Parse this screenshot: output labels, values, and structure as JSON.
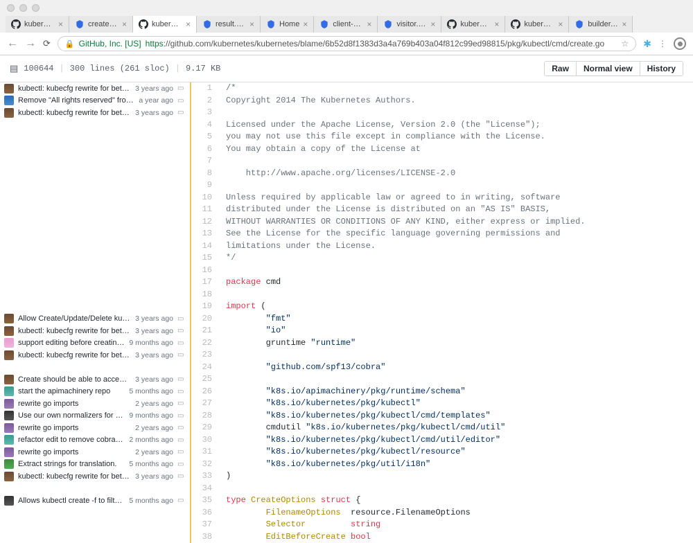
{
  "browser": {
    "tabs": [
      {
        "title": "kubernetes/r",
        "icon": "github"
      },
      {
        "title": "create.go —",
        "icon": "k8s"
      },
      {
        "title": "kubernetes/h",
        "icon": "github"
      },
      {
        "title": "result.go — k",
        "icon": "k8s"
      },
      {
        "title": "Home",
        "icon": "k8s"
      },
      {
        "title": "client-go — k",
        "icon": "k8s"
      },
      {
        "title": "visitor.go —",
        "icon": "k8s"
      },
      {
        "title": "kubernetes/t",
        "icon": "github"
      },
      {
        "title": "kubernetes/t",
        "icon": "github"
      },
      {
        "title": "builder.go —",
        "icon": "k8s"
      }
    ],
    "active_tab": 2,
    "url_org": "GitHub, Inc. [US]",
    "url_protocol": "https",
    "url_path": "://github.com/kubernetes/kubernetes/blame/6b52d8f1383d3a4a769b403a04f812c99ed98815/pkg/kubectl/cmd/create.go"
  },
  "file_toolbar": {
    "file_id": "100644",
    "line_count": "300 lines (261 sloc)",
    "size": "9.17 KB",
    "buttons": {
      "raw": "Raw",
      "normal": "Normal view",
      "history": "History"
    }
  },
  "blame_rows": [
    {
      "type": "row",
      "msg": "kubectl: kubecfg rewrite for better m...",
      "age": "3 years ago",
      "avatar": "av-brown",
      "reblame": true
    },
    {
      "type": "row",
      "msg": "Remove \"All rights reserved\" from all...",
      "age": "a year ago",
      "avatar": "av-blue",
      "reblame": true
    },
    {
      "type": "row",
      "msg": "kubectl: kubecfg rewrite for better m...",
      "age": "3 years ago",
      "avatar": "av-brown",
      "reblame": true
    },
    {
      "type": "spacer",
      "count": 16
    },
    {
      "type": "row",
      "msg": "Allow Create/Update/Delete kubectl ...",
      "age": "3 years ago",
      "avatar": "av-brown",
      "reblame": true
    },
    {
      "type": "row",
      "msg": "kubectl: kubecfg rewrite for better m...",
      "age": "3 years ago",
      "avatar": "av-brown",
      "reblame": true
    },
    {
      "type": "row",
      "msg": "support editing before creating reso...",
      "age": "9 months ago",
      "avatar": "av-pink",
      "reblame": true
    },
    {
      "type": "row",
      "msg": "kubectl: kubecfg rewrite for better m...",
      "age": "3 years ago",
      "avatar": "av-brown",
      "reblame": true
    },
    {
      "type": "spacer",
      "count": 1
    },
    {
      "type": "row",
      "msg": "Create should be able to accept mult...",
      "age": "3 years ago",
      "avatar": "av-brown",
      "reblame": true
    },
    {
      "type": "row",
      "msg": "start the apimachinery repo",
      "age": "5 months ago",
      "avatar": "av-teal",
      "reblame": true
    },
    {
      "type": "row",
      "msg": "rewrite go imports",
      "age": "2 years ago",
      "avatar": "av-purple",
      "reblame": true
    },
    {
      "type": "row",
      "msg": "Use our own normalizers for cmd exa...",
      "age": "9 months ago",
      "avatar": "av-dark",
      "reblame": true
    },
    {
      "type": "row",
      "msg": "rewrite go imports",
      "age": "2 years ago",
      "avatar": "av-purple",
      "reblame": true
    },
    {
      "type": "row",
      "msg": "refactor edit to remove cobra depen...",
      "age": "2 months ago",
      "avatar": "av-teal",
      "reblame": true
    },
    {
      "type": "row",
      "msg": "rewrite go imports",
      "age": "2 years ago",
      "avatar": "av-purple",
      "reblame": true
    },
    {
      "type": "row",
      "msg": "Extract strings for translation.",
      "age": "5 months ago",
      "avatar": "av-green",
      "reblame": true
    },
    {
      "type": "row",
      "msg": "kubectl: kubecfg rewrite for better m...",
      "age": "3 years ago",
      "avatar": "av-brown",
      "reblame": true
    },
    {
      "type": "spacer",
      "count": 1
    },
    {
      "type": "row",
      "msg": "Allows kubectl create -f to filter by s...",
      "age": "5 months ago",
      "avatar": "av-dark",
      "reblame": true
    }
  ],
  "code": {
    "start_line": 1,
    "lines": [
      {
        "t": "comment",
        "c": "/*"
      },
      {
        "t": "comment",
        "c": "Copyright 2014 The Kubernetes Authors."
      },
      {
        "t": "blank",
        "c": ""
      },
      {
        "t": "comment",
        "c": "Licensed under the Apache License, Version 2.0 (the \"License\");"
      },
      {
        "t": "comment",
        "c": "you may not use this file except in compliance with the License."
      },
      {
        "t": "comment",
        "c": "You may obtain a copy of the License at"
      },
      {
        "t": "blank",
        "c": ""
      },
      {
        "t": "comment",
        "c": "    http://www.apache.org/licenses/LICENSE-2.0"
      },
      {
        "t": "blank",
        "c": ""
      },
      {
        "t": "comment",
        "c": "Unless required by applicable law or agreed to in writing, software"
      },
      {
        "t": "comment",
        "c": "distributed under the License is distributed on an \"AS IS\" BASIS,"
      },
      {
        "t": "comment",
        "c": "WITHOUT WARRANTIES OR CONDITIONS OF ANY KIND, either express or implied."
      },
      {
        "t": "comment",
        "c": "See the License for the specific language governing permissions and"
      },
      {
        "t": "comment",
        "c": "limitations under the License."
      },
      {
        "t": "comment",
        "c": "*/"
      },
      {
        "t": "blank",
        "c": ""
      },
      {
        "t": "package",
        "c": "package cmd"
      },
      {
        "t": "blank",
        "c": ""
      },
      {
        "t": "import",
        "c": "import ("
      },
      {
        "t": "string",
        "c": "        \"fmt\""
      },
      {
        "t": "string",
        "c": "        \"io\""
      },
      {
        "t": "aliasimport",
        "c": "        gruntime \"runtime\""
      },
      {
        "t": "blank",
        "c": ""
      },
      {
        "t": "string",
        "c": "        \"github.com/spf13/cobra\""
      },
      {
        "t": "blank",
        "c": ""
      },
      {
        "t": "string",
        "c": "        \"k8s.io/apimachinery/pkg/runtime/schema\""
      },
      {
        "t": "string",
        "c": "        \"k8s.io/kubernetes/pkg/kubectl\""
      },
      {
        "t": "string",
        "c": "        \"k8s.io/kubernetes/pkg/kubectl/cmd/templates\""
      },
      {
        "t": "aliasimport",
        "c": "        cmdutil \"k8s.io/kubernetes/pkg/kubectl/cmd/util\""
      },
      {
        "t": "string",
        "c": "        \"k8s.io/kubernetes/pkg/kubectl/cmd/util/editor\""
      },
      {
        "t": "string",
        "c": "        \"k8s.io/kubernetes/pkg/kubectl/resource\""
      },
      {
        "t": "string",
        "c": "        \"k8s.io/kubernetes/pkg/util/i18n\""
      },
      {
        "t": "plain",
        "c": ")"
      },
      {
        "t": "blank",
        "c": ""
      },
      {
        "t": "struct",
        "c": "type CreateOptions struct {"
      },
      {
        "t": "field",
        "c": "        FilenameOptions  resource.FilenameOptions"
      },
      {
        "t": "field2",
        "c": "        Selector         string"
      },
      {
        "t": "field2",
        "c": "        EditBeforeCreate bool"
      }
    ]
  }
}
